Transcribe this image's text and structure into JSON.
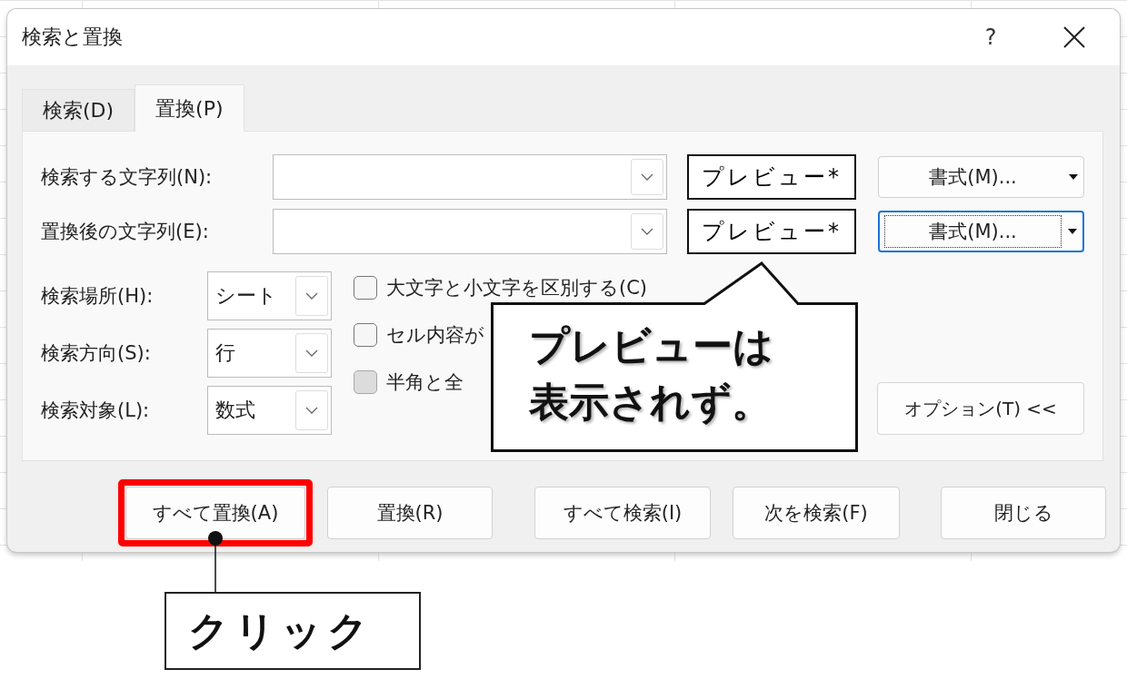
{
  "window": {
    "title": "検索と置換",
    "help": "?"
  },
  "tabs": [
    {
      "label": "検索(D)",
      "selected": false
    },
    {
      "label": "置換(P)",
      "selected": true
    }
  ],
  "fields": [
    {
      "label": "検索する文字列(N):",
      "preview": "プレビュー*",
      "format_button": "書式(M)...",
      "focused": false
    },
    {
      "label": "置換後の文字列(E):",
      "preview": "プレビュー*",
      "format_button": "書式(M)...",
      "focused": true
    }
  ],
  "options": [
    {
      "label": "検索場所(H):",
      "value": "シート"
    },
    {
      "label": "検索方向(S):",
      "value": "行"
    },
    {
      "label": "検索対象(L):",
      "value": "数式"
    }
  ],
  "checkboxes": [
    {
      "label": "大文字と小文字を区別する(C)",
      "checked": false,
      "disabled": false
    },
    {
      "label": "セル内容が",
      "checked": false,
      "disabled": false
    },
    {
      "label": "半角と全",
      "checked": false,
      "disabled": true
    }
  ],
  "options_button": "オプション(T) <<",
  "buttons": [
    {
      "label": "すべて置換(A)",
      "highlighted": true
    },
    {
      "label": "置換(R)",
      "highlighted": false
    },
    {
      "label": "すべて検索(I)",
      "highlighted": false
    },
    {
      "label": "次を検索(F)",
      "highlighted": false
    },
    {
      "label": "閉じる",
      "highlighted": false
    }
  ],
  "callout": {
    "lines": [
      "プレビューは",
      "表示されず。"
    ]
  },
  "click_label": "クリック"
}
